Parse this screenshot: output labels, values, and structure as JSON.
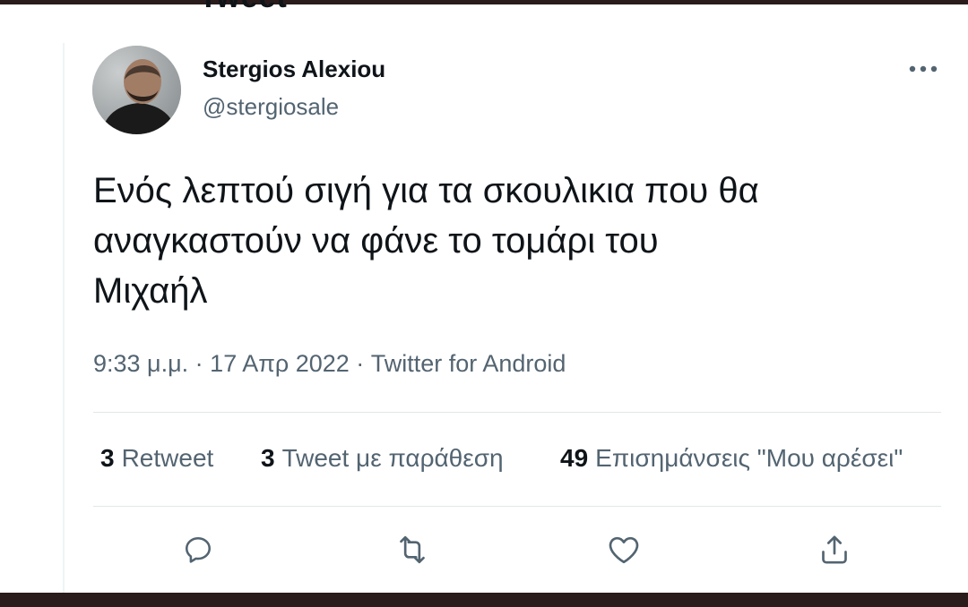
{
  "header": {
    "title_fragment": "Tweet"
  },
  "author": {
    "display_name": "Stergios Alexiou",
    "handle": "@stergiosale",
    "avatar_icon": "person-photo-avatar"
  },
  "more_icon": "more-dots-icon",
  "tweet": {
    "text_lines": [
      "Ενός λεπτού σιγή για τα σκουλικια που θα",
      "αναγκαστούν να φάνε το τομάρι του",
      "Μιχαήλ"
    ],
    "time": "9:33 μ.μ.",
    "separator": " · ",
    "date": "17 Απρ 2022",
    "source": "Twitter for Android"
  },
  "stats": [
    {
      "count": "3",
      "label": "Retweet"
    },
    {
      "count": "3",
      "label": "Tweet με παράθεση"
    },
    {
      "count": "49",
      "label": "Επισημάνσεις \"Μου αρέσει\""
    }
  ],
  "actions": [
    {
      "name": "reply",
      "icon": "reply-icon"
    },
    {
      "name": "retweet",
      "icon": "retweet-icon"
    },
    {
      "name": "like",
      "icon": "heart-icon"
    },
    {
      "name": "share",
      "icon": "share-icon"
    }
  ],
  "colors": {
    "text_primary": "#0f1419",
    "text_secondary": "#536471",
    "divider": "#e1e6e8",
    "frame": "#2a1c1c"
  }
}
